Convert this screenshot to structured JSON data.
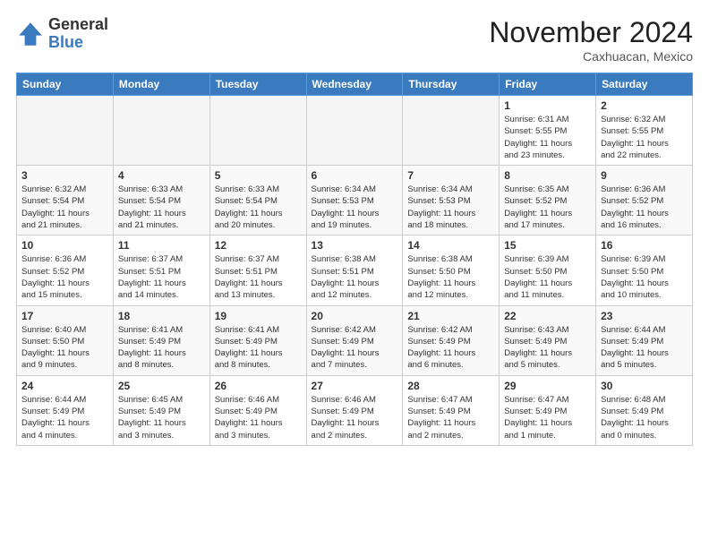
{
  "header": {
    "logo_general": "General",
    "logo_blue": "Blue",
    "month_title": "November 2024",
    "location": "Caxhuacan, Mexico"
  },
  "days_of_week": [
    "Sunday",
    "Monday",
    "Tuesday",
    "Wednesday",
    "Thursday",
    "Friday",
    "Saturday"
  ],
  "weeks": [
    [
      {
        "day": "",
        "info": "",
        "empty": true
      },
      {
        "day": "",
        "info": "",
        "empty": true
      },
      {
        "day": "",
        "info": "",
        "empty": true
      },
      {
        "day": "",
        "info": "",
        "empty": true
      },
      {
        "day": "",
        "info": "",
        "empty": true
      },
      {
        "day": "1",
        "info": "Sunrise: 6:31 AM\nSunset: 5:55 PM\nDaylight: 11 hours\nand 23 minutes."
      },
      {
        "day": "2",
        "info": "Sunrise: 6:32 AM\nSunset: 5:55 PM\nDaylight: 11 hours\nand 22 minutes."
      }
    ],
    [
      {
        "day": "3",
        "info": "Sunrise: 6:32 AM\nSunset: 5:54 PM\nDaylight: 11 hours\nand 21 minutes."
      },
      {
        "day": "4",
        "info": "Sunrise: 6:33 AM\nSunset: 5:54 PM\nDaylight: 11 hours\nand 21 minutes."
      },
      {
        "day": "5",
        "info": "Sunrise: 6:33 AM\nSunset: 5:54 PM\nDaylight: 11 hours\nand 20 minutes."
      },
      {
        "day": "6",
        "info": "Sunrise: 6:34 AM\nSunset: 5:53 PM\nDaylight: 11 hours\nand 19 minutes."
      },
      {
        "day": "7",
        "info": "Sunrise: 6:34 AM\nSunset: 5:53 PM\nDaylight: 11 hours\nand 18 minutes."
      },
      {
        "day": "8",
        "info": "Sunrise: 6:35 AM\nSunset: 5:52 PM\nDaylight: 11 hours\nand 17 minutes."
      },
      {
        "day": "9",
        "info": "Sunrise: 6:36 AM\nSunset: 5:52 PM\nDaylight: 11 hours\nand 16 minutes."
      }
    ],
    [
      {
        "day": "10",
        "info": "Sunrise: 6:36 AM\nSunset: 5:52 PM\nDaylight: 11 hours\nand 15 minutes."
      },
      {
        "day": "11",
        "info": "Sunrise: 6:37 AM\nSunset: 5:51 PM\nDaylight: 11 hours\nand 14 minutes."
      },
      {
        "day": "12",
        "info": "Sunrise: 6:37 AM\nSunset: 5:51 PM\nDaylight: 11 hours\nand 13 minutes."
      },
      {
        "day": "13",
        "info": "Sunrise: 6:38 AM\nSunset: 5:51 PM\nDaylight: 11 hours\nand 12 minutes."
      },
      {
        "day": "14",
        "info": "Sunrise: 6:38 AM\nSunset: 5:50 PM\nDaylight: 11 hours\nand 12 minutes."
      },
      {
        "day": "15",
        "info": "Sunrise: 6:39 AM\nSunset: 5:50 PM\nDaylight: 11 hours\nand 11 minutes."
      },
      {
        "day": "16",
        "info": "Sunrise: 6:39 AM\nSunset: 5:50 PM\nDaylight: 11 hours\nand 10 minutes."
      }
    ],
    [
      {
        "day": "17",
        "info": "Sunrise: 6:40 AM\nSunset: 5:50 PM\nDaylight: 11 hours\nand 9 minutes."
      },
      {
        "day": "18",
        "info": "Sunrise: 6:41 AM\nSunset: 5:49 PM\nDaylight: 11 hours\nand 8 minutes."
      },
      {
        "day": "19",
        "info": "Sunrise: 6:41 AM\nSunset: 5:49 PM\nDaylight: 11 hours\nand 8 minutes."
      },
      {
        "day": "20",
        "info": "Sunrise: 6:42 AM\nSunset: 5:49 PM\nDaylight: 11 hours\nand 7 minutes."
      },
      {
        "day": "21",
        "info": "Sunrise: 6:42 AM\nSunset: 5:49 PM\nDaylight: 11 hours\nand 6 minutes."
      },
      {
        "day": "22",
        "info": "Sunrise: 6:43 AM\nSunset: 5:49 PM\nDaylight: 11 hours\nand 5 minutes."
      },
      {
        "day": "23",
        "info": "Sunrise: 6:44 AM\nSunset: 5:49 PM\nDaylight: 11 hours\nand 5 minutes."
      }
    ],
    [
      {
        "day": "24",
        "info": "Sunrise: 6:44 AM\nSunset: 5:49 PM\nDaylight: 11 hours\nand 4 minutes."
      },
      {
        "day": "25",
        "info": "Sunrise: 6:45 AM\nSunset: 5:49 PM\nDaylight: 11 hours\nand 3 minutes."
      },
      {
        "day": "26",
        "info": "Sunrise: 6:46 AM\nSunset: 5:49 PM\nDaylight: 11 hours\nand 3 minutes."
      },
      {
        "day": "27",
        "info": "Sunrise: 6:46 AM\nSunset: 5:49 PM\nDaylight: 11 hours\nand 2 minutes."
      },
      {
        "day": "28",
        "info": "Sunrise: 6:47 AM\nSunset: 5:49 PM\nDaylight: 11 hours\nand 2 minutes."
      },
      {
        "day": "29",
        "info": "Sunrise: 6:47 AM\nSunset: 5:49 PM\nDaylight: 11 hours\nand 1 minute."
      },
      {
        "day": "30",
        "info": "Sunrise: 6:48 AM\nSunset: 5:49 PM\nDaylight: 11 hours\nand 0 minutes."
      }
    ]
  ]
}
